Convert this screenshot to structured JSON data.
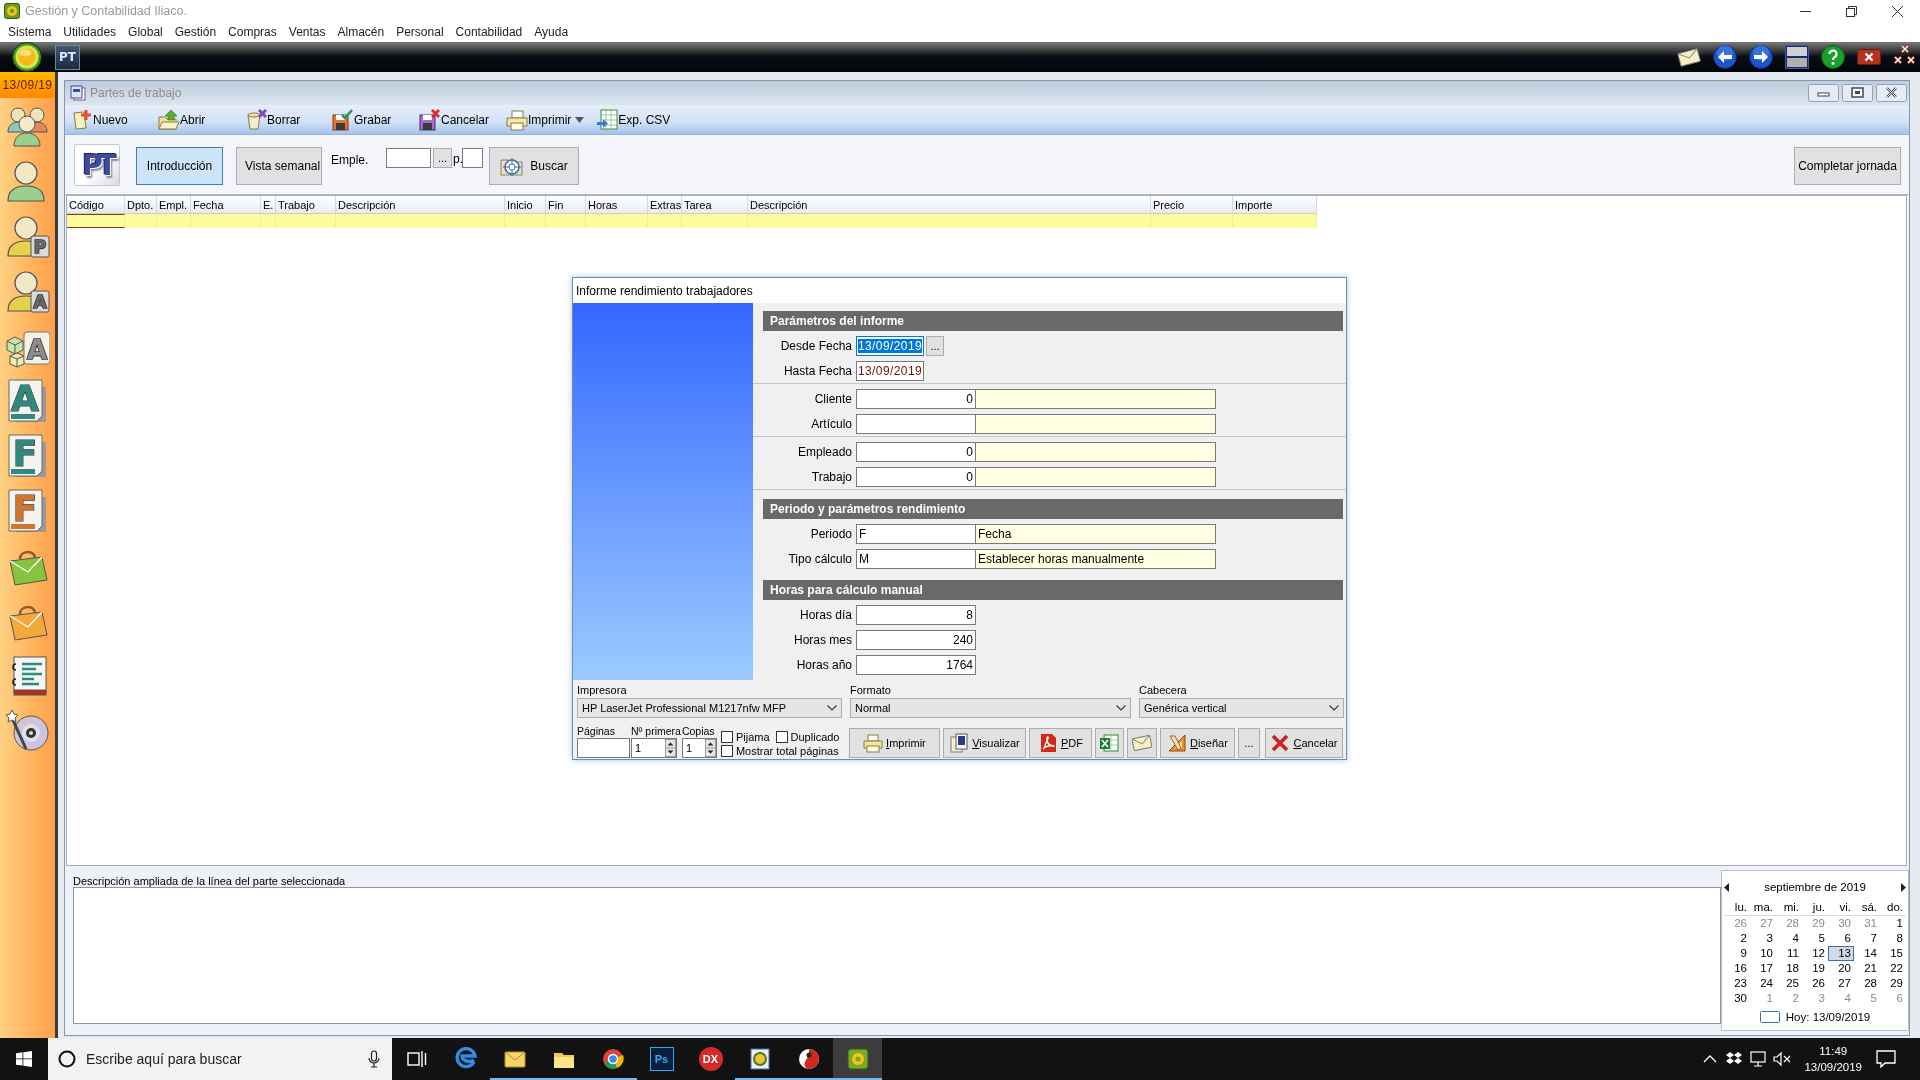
{
  "window": {
    "title": "Gestión y Contabilidad Iliaco."
  },
  "menu": [
    "Sistema",
    "Utilidades",
    "Global",
    "Gestión",
    "Compras",
    "Ventas",
    "Almacén",
    "Personal",
    "Contabilidad",
    "Ayuda"
  ],
  "quick_bar": {
    "windows": [
      {
        "label": "PT",
        "selected": true
      }
    ]
  },
  "sidebar": {
    "date": "13/09/19",
    "items": [
      {
        "kind": "group"
      },
      {
        "kind": "person"
      },
      {
        "kind": "person",
        "letter": "P"
      },
      {
        "kind": "person",
        "letter": "A"
      },
      {
        "kind": "boxes",
        "letter": "A"
      },
      {
        "kind": "document",
        "letter": "A",
        "color": "#2e8a80"
      },
      {
        "kind": "document",
        "letter": "F",
        "color": "#2e8a80"
      },
      {
        "kind": "document",
        "letter": "F",
        "color": "#d2762e"
      },
      {
        "kind": "bag",
        "color": "#86c440"
      },
      {
        "kind": "bag",
        "color": "#f2a83a"
      },
      {
        "kind": "notebook"
      },
      {
        "kind": "disc"
      }
    ]
  },
  "child_window": {
    "title": "Partes de trabajo",
    "toolbar": [
      {
        "label": "Nuevo",
        "dropdown": false
      },
      {
        "label": "Abrir",
        "dropdown": false
      },
      {
        "label": "Borrar",
        "dropdown": false
      },
      {
        "label": "Grabar",
        "dropdown": false
      },
      {
        "label": "Cancelar",
        "dropdown": false
      },
      {
        "label": "Imprimir",
        "dropdown": true
      },
      {
        "label": "Exp. CSV",
        "dropdown": false
      }
    ],
    "logo": "PT",
    "views": [
      {
        "label": "Introducción",
        "selected": true
      },
      {
        "label": "Vista semanal",
        "selected": false
      }
    ],
    "employee_filter": {
      "label": "Emple.",
      "browse": "...",
      "page_label": "p."
    },
    "search_button": "Buscar",
    "complete_button": "Completar jornada",
    "table": {
      "columns": [
        "Código",
        "Dpto.",
        "Empl.",
        "Fecha",
        "E.",
        "Trabajo",
        "Descripción",
        "Inicio",
        "Fin",
        "Horas",
        "Extras",
        "Tarea",
        "Descripción",
        "Precio",
        "Importe"
      ],
      "rows": [
        {
          "selected": true
        }
      ]
    },
    "detail": {
      "label": "Descripción ampliada de la línea del parte seleccionada"
    },
    "calendar": {
      "month": "septiembre de 2019",
      "weekdays": [
        "lu.",
        "ma.",
        "mi.",
        "ju.",
        "vi.",
        "sá.",
        "do."
      ],
      "weeks": [
        [
          {
            "day": "26",
            "other_month": true,
            "selected": false
          },
          {
            "day": "27",
            "other_month": true,
            "selected": false
          },
          {
            "day": "28",
            "other_month": true,
            "selected": false
          },
          {
            "day": "29",
            "other_month": true,
            "selected": false
          },
          {
            "day": "30",
            "other_month": true,
            "selected": false
          },
          {
            "day": "31",
            "other_month": true,
            "selected": false
          },
          {
            "day": "1",
            "other_month": false,
            "selected": false
          }
        ],
        [
          {
            "day": "2",
            "other_month": false,
            "selected": false
          },
          {
            "day": "3",
            "other_month": false,
            "selected": false
          },
          {
            "day": "4",
            "other_month": false,
            "selected": false
          },
          {
            "day": "5",
            "other_month": false,
            "selected": false
          },
          {
            "day": "6",
            "other_month": false,
            "selected": false
          },
          {
            "day": "7",
            "other_month": false,
            "selected": false
          },
          {
            "day": "8",
            "other_month": false,
            "selected": false
          }
        ],
        [
          {
            "day": "9",
            "other_month": false,
            "selected": false
          },
          {
            "day": "10",
            "other_month": false,
            "selected": false
          },
          {
            "day": "11",
            "other_month": false,
            "selected": false
          },
          {
            "day": "12",
            "other_month": false,
            "selected": false
          },
          {
            "day": "13",
            "other_month": false,
            "selected": true
          },
          {
            "day": "14",
            "other_month": false,
            "selected": false
          },
          {
            "day": "15",
            "other_month": false,
            "selected": false
          }
        ],
        [
          {
            "day": "16",
            "other_month": false,
            "selected": false
          },
          {
            "day": "17",
            "other_month": false,
            "selected": false
          },
          {
            "day": "18",
            "other_month": false,
            "selected": false
          },
          {
            "day": "19",
            "other_month": false,
            "selected": false
          },
          {
            "day": "20",
            "other_month": false,
            "selected": false
          },
          {
            "day": "21",
            "other_month": false,
            "selected": false
          },
          {
            "day": "22",
            "other_month": false,
            "selected": false
          }
        ],
        [
          {
            "day": "23",
            "other_month": false,
            "selected": false
          },
          {
            "day": "24",
            "other_month": false,
            "selected": false
          },
          {
            "day": "25",
            "other_month": false,
            "selected": false
          },
          {
            "day": "26",
            "other_month": false,
            "selected": false
          },
          {
            "day": "27",
            "other_month": false,
            "selected": false
          },
          {
            "day": "28",
            "other_month": false,
            "selected": false
          },
          {
            "day": "29",
            "other_month": false,
            "selected": false
          }
        ],
        [
          {
            "day": "30",
            "other_month": false,
            "selected": false
          },
          {
            "day": "1",
            "other_month": true,
            "selected": false
          },
          {
            "day": "2",
            "other_month": true,
            "selected": false
          },
          {
            "day": "3",
            "other_month": true,
            "selected": false
          },
          {
            "day": "4",
            "other_month": true,
            "selected": false
          },
          {
            "day": "5",
            "other_month": true,
            "selected": false
          },
          {
            "day": "6",
            "other_month": true,
            "selected": false
          }
        ]
      ],
      "today": "Hoy: 13/09/2019"
    }
  },
  "dialog": {
    "title": "Informe rendimiento trabajadores",
    "sections": [
      {
        "title": "Parámetros del informe",
        "groups": [
          [
            {
              "kind": "date",
              "label": "Desde Fecha",
              "value": "13/09/2019",
              "selected": true,
              "button": "..."
            },
            {
              "kind": "date",
              "label": "Hasta Fecha",
              "value": "13/09/2019",
              "selected": false
            }
          ],
          [
            {
              "kind": "lookup",
              "label": "Cliente",
              "code": "0"
            },
            {
              "kind": "lookup",
              "label": "Artículo"
            }
          ],
          [
            {
              "kind": "lookup",
              "label": "Empleado",
              "code": "0"
            },
            {
              "kind": "lookup",
              "label": "Trabajo",
              "code": "0"
            }
          ]
        ]
      },
      {
        "title": "Periodo y parámetros rendimiento",
        "groups": [
          [
            {
              "kind": "option",
              "label": "Periodo",
              "code": "F",
              "description": "Fecha"
            },
            {
              "kind": "option",
              "label": "Tipo cálculo",
              "code": "M",
              "description": "Establecer horas manualmente"
            }
          ]
        ]
      },
      {
        "title": "Horas para cálculo manual",
        "groups": [
          [
            {
              "kind": "number",
              "label": "Horas día",
              "value": "8"
            },
            {
              "kind": "number",
              "label": "Horas mes",
              "value": "240"
            },
            {
              "kind": "number",
              "label": "Horas año",
              "value": "1764"
            }
          ]
        ]
      }
    ],
    "selects": [
      {
        "label": "Impresora",
        "value": "HP LaserJet Professional M1217nfw MFP"
      },
      {
        "label": "Formato",
        "value": "Normal"
      },
      {
        "label": "Cabecera",
        "value": "Genérica vertical"
      }
    ],
    "pages": {
      "label": "Páginas"
    },
    "spinners": [
      {
        "label": "Nº primera",
        "value": "1"
      },
      {
        "label": "Copias",
        "value": "1"
      }
    ],
    "checkboxes": [
      {
        "label": "Pijama",
        "checked": false
      },
      {
        "label": "Duplicado",
        "checked": false
      },
      {
        "label": "Mostrar total páginas",
        "checked": false
      }
    ],
    "buttons": [
      {
        "kind": "icon_text",
        "label": "Imprimir",
        "access_key": true
      },
      {
        "kind": "icon_text",
        "label": "Visualizar",
        "access_key": true
      },
      {
        "kind": "icon_text",
        "label": "PDF",
        "access_key": true
      },
      {
        "kind": "icon"
      },
      {
        "kind": "icon"
      },
      {
        "kind": "icon_text",
        "label": "Diseñar",
        "access_key": true
      },
      {
        "kind": "text",
        "label": "...",
        "access_key": false
      },
      {
        "kind": "icon_text",
        "label": "Cancelar",
        "access_key": true
      }
    ]
  },
  "taskbar": {
    "search": {
      "placeholder": "Escribe aquí para buscar"
    },
    "apps": [
      {
        "active": false,
        "running": false
      },
      {
        "active": false,
        "running": true
      },
      {
        "active": false,
        "running": true
      },
      {
        "active": false,
        "running": true
      },
      {
        "label": "Ps",
        "active": false,
        "running": false
      },
      {
        "label": "DX",
        "active": false,
        "running": false
      },
      {
        "active": false,
        "running": true
      },
      {
        "active": false,
        "running": true
      },
      {
        "active": true,
        "running": true
      }
    ],
    "clock": {
      "time": "11:49",
      "date": "13/09/2019"
    }
  }
}
